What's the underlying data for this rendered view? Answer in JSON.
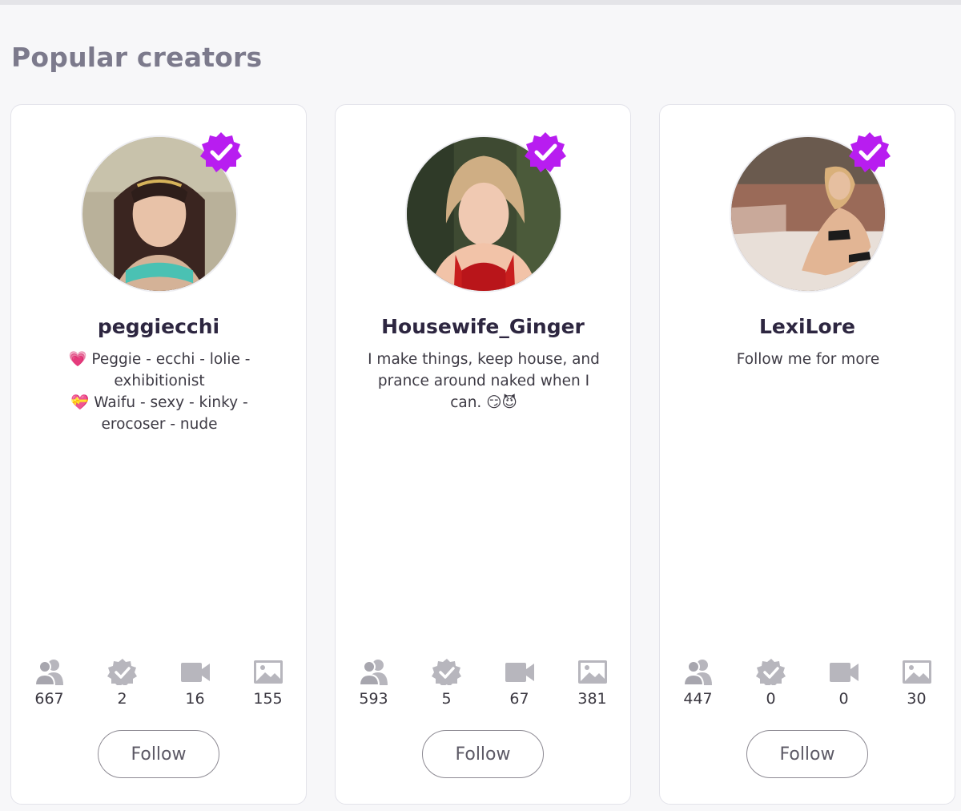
{
  "section": {
    "title": "Popular creators"
  },
  "colors": {
    "verified": "#b81df0",
    "stat_icon": "#b7b6bd"
  },
  "icons": [
    "followers-icon",
    "verified-badge-icon",
    "video-icon",
    "image-icon",
    "verified-check-icon"
  ],
  "creators": [
    {
      "username": "peggiecchi",
      "bio": [
        "💗 Peggie - ecchi - lolie -",
        "exhibitionist",
        "💝 Waifu - sexy - kinky -",
        "erocoser - nude"
      ],
      "stats": {
        "followers": "667",
        "verified": "2",
        "videos": "16",
        "images": "155"
      },
      "follow_label": "Follow"
    },
    {
      "username": "Housewife_Ginger",
      "bio": [
        "I make things, keep house, and",
        "prance around naked when I",
        "can. 😏😈"
      ],
      "stats": {
        "followers": "593",
        "verified": "5",
        "videos": "67",
        "images": "381"
      },
      "follow_label": "Follow"
    },
    {
      "username": "LexiLore",
      "bio": [
        "Follow me for more"
      ],
      "stats": {
        "followers": "447",
        "verified": "0",
        "videos": "0",
        "images": "30"
      },
      "follow_label": "Follow"
    }
  ]
}
